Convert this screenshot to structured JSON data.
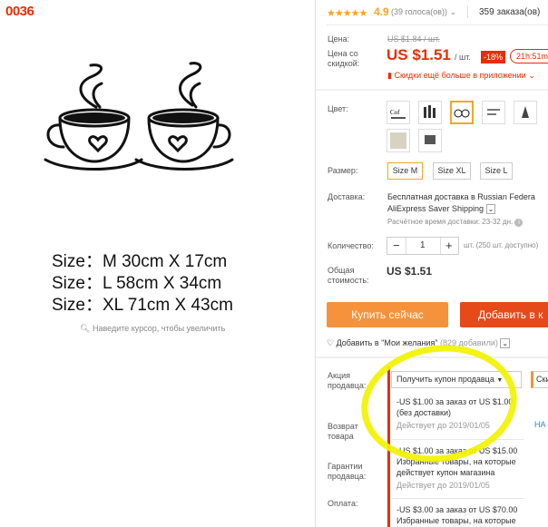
{
  "image_id": "0036",
  "left_panel": {
    "sizes": [
      "Size：M 30cm X 17cm",
      "Size：L 58cm X 34cm",
      "Size：XL 71cm X 43cm"
    ],
    "zoom_hint": "Наведите курсор, чтобы увеличить"
  },
  "header": {
    "rating": "4.9",
    "votes": "(39 голоса(ов))",
    "orders": "359 заказа(ов)"
  },
  "price": {
    "label": "Цена:",
    "old_price": "US $1.84 / шт.",
    "discount_label": "Цена со скидкой:",
    "price": "US $1.51",
    "unit": "/ шт.",
    "discount": "-18%",
    "timer": "21h:51m",
    "app_promo": "Скидки ещё больше в приложении"
  },
  "color": {
    "label": "Цвет:"
  },
  "size": {
    "label": "Размер:",
    "options": [
      "Size M",
      "Size XL",
      "Size L"
    ],
    "selected": "Size M"
  },
  "delivery": {
    "label": "Доставка:",
    "line1": "Бесплатная доставка в Russian Federa",
    "line2": "AliExpress Saver Shipping",
    "line3": "Расчётное время доставки: 23-32 дн."
  },
  "quantity": {
    "label": "Количество:",
    "value": "1",
    "minus": "−",
    "plus": "+",
    "stock": "шт. (250 шт. доступно)"
  },
  "total": {
    "label1": "Общая",
    "label2": "стоимость:",
    "value": "US $1.51"
  },
  "actions": {
    "buy": "Купить сейчас",
    "cart": "Добавить в к",
    "wishlist": "Добавить в \"Мои желания\"",
    "wishlist_count": "(829 добавили)"
  },
  "promo": {
    "label1": "Акция",
    "label2": "продавца:",
    "coupon_button": "Получить купон продавца",
    "coupon_button2": "Скид",
    "return_label1": "Возврат",
    "return_label2": "товара",
    "guarantee1": "Гарантии",
    "guarantee2": "продавца:",
    "payment": "Оплата:",
    "nav": "НА",
    "coupons": [
      {
        "l1": "-US $1.00 за заказ от US $1.00",
        "l2": "(без доставки)",
        "exp": "Действует до 2019/01/05"
      },
      {
        "l1": "-US $1.00 за заказ от US $15.00",
        "l2": "Избранные товары, на которые",
        "l3": "действует купон магазина",
        "exp": "Действует до 2019/01/05"
      },
      {
        "l1": "-US $3.00 за заказ от US $70.00",
        "l2": "Избранные товары, на которые"
      }
    ]
  },
  "colors": {
    "accent": "#e62e04",
    "star": "#f5a623",
    "buy": "#f5923b",
    "cart": "#e64a19",
    "highlight": "#f2f200"
  }
}
